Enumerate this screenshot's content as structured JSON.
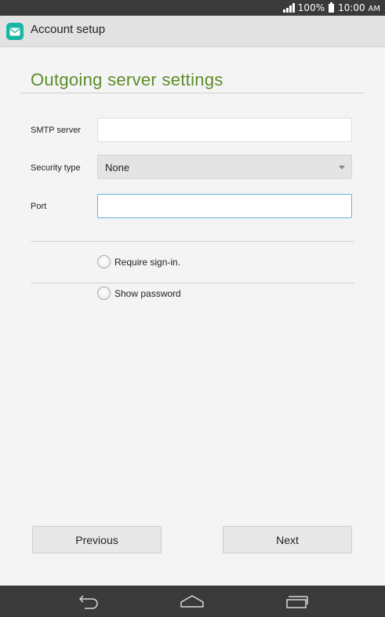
{
  "status_bar": {
    "battery": "100%",
    "time": "10:00",
    "ampm": "AM"
  },
  "action_bar": {
    "title": "Account setup",
    "app_icon": "email-icon",
    "accent": "#18b6a3"
  },
  "page": {
    "title": "Outgoing server settings",
    "title_color": "#5b8c2a",
    "fields": {
      "smtp_label": "SMTP server",
      "smtp_value": "",
      "security_label": "Security type",
      "security_value": "None",
      "port_label": "Port",
      "port_value": ""
    },
    "options": {
      "require_signin": "Require sign-in.",
      "show_password": "Show password"
    }
  },
  "buttons": {
    "previous": "Previous",
    "next": "Next"
  },
  "nav": {
    "back": "back-icon",
    "home": "home-icon",
    "recents": "recents-icon"
  }
}
